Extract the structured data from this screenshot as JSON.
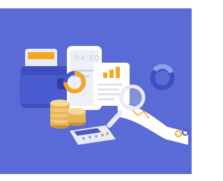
{
  "illustration": {
    "background_color": "#5a6bd6",
    "phone_clock": "04:00",
    "palette": {
      "primary_blue": "#4a57c7",
      "dark_blue": "#3242a8",
      "orange": "#f5a623",
      "gold": "#e8b45a",
      "white": "#ffffff",
      "light_grey": "#e8ebf5"
    },
    "objects": [
      "wallet-icon",
      "smartphone-icon",
      "bar-chart-icon",
      "donut-chart-icon",
      "coin-stack-icon",
      "calculator-icon",
      "magnifier-icon",
      "ribbon-line-chart-icon",
      "ring-icon"
    ]
  }
}
